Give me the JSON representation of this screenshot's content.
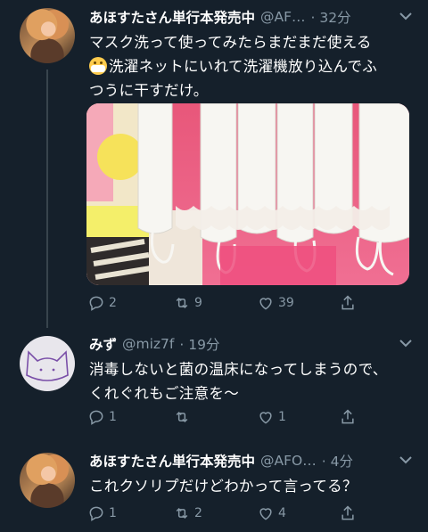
{
  "tweets": [
    {
      "name": "あほすたさん単行本発売中",
      "handle": "@AF…",
      "time": "· 32分",
      "text_line1": "マスク洗って使ってみたらまだまだ使える",
      "text_line2": "洗濯ネットにいれて洗濯機放り込んでふ",
      "text_line3": "つうに干すだけ。",
      "replies": "2",
      "retweets": "9",
      "likes": "39"
    },
    {
      "name": "みず",
      "handle": "@miz7f",
      "time": "· 19分",
      "text_line1": "消毒しないと菌の温床になってしまうので、",
      "text_line2": "くれぐれもご注意を〜",
      "replies": "1",
      "retweets": "",
      "likes": "1"
    },
    {
      "name": "あほすたさん単行本発売中",
      "handle": "@AFO…",
      "time": "· 4分",
      "text_line1": "これクソリプだけどわかって言ってる？",
      "replies": "1",
      "retweets": "2",
      "likes": "4"
    }
  ],
  "colors": {
    "background": "#15202b",
    "text": "#ffffff",
    "secondary": "#8899a6",
    "divider": "#38444d"
  },
  "icons": [
    "reply-icon",
    "retweet-icon",
    "like-icon",
    "share-icon",
    "chevron-down-icon",
    "mask-emoji-icon"
  ]
}
